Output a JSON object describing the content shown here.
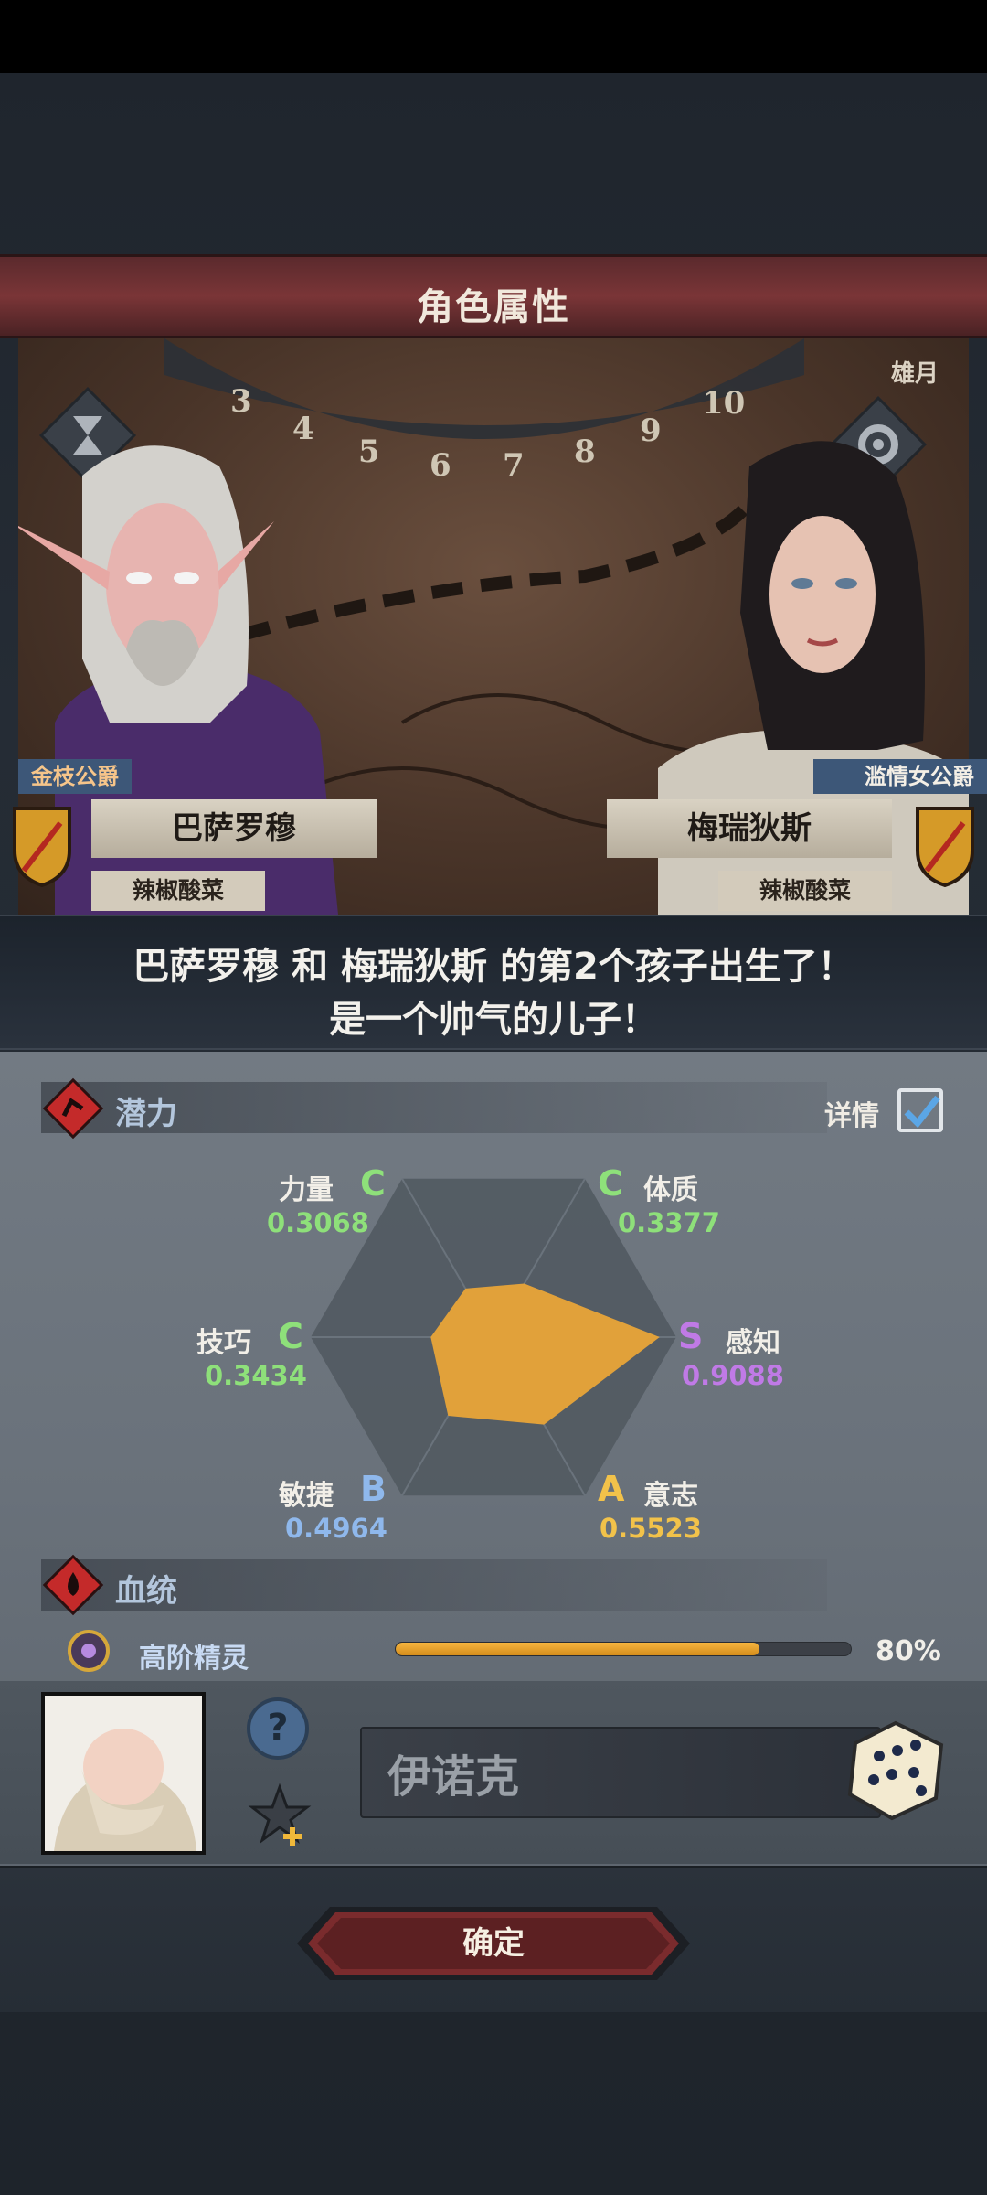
{
  "header": {
    "title": "角色属性"
  },
  "scene": {
    "map_label": "雄月"
  },
  "father": {
    "title": "金枝公爵",
    "name": "巴萨罗穆",
    "subtitle": "辣椒酸菜"
  },
  "mother": {
    "title": "滥情女公爵",
    "name": "梅瑞狄斯",
    "subtitle": "辣椒酸菜"
  },
  "message": {
    "line1": "巴萨罗穆 和 梅瑞狄斯 的第2个孩子出生了！",
    "line2": "是一个帅气的儿子！"
  },
  "potential": {
    "title": "潜力",
    "detail_label": "详情",
    "detail_checked": true,
    "stats": [
      {
        "name": "力量",
        "grade": "C",
        "value": "0.3068",
        "color": "#8ee07a",
        "level": 0.3068
      },
      {
        "name": "体质",
        "grade": "C",
        "value": "0.3377",
        "color": "#8ee07a",
        "level": 0.3377
      },
      {
        "name": "感知",
        "grade": "S",
        "value": "0.9088",
        "color": "#c07ae6",
        "level": 0.9088
      },
      {
        "name": "意志",
        "grade": "A",
        "value": "0.5523",
        "color": "#f2c24a",
        "level": 0.5523
      },
      {
        "name": "敏捷",
        "grade": "B",
        "value": "0.4964",
        "color": "#8fb8ec",
        "level": 0.4964
      },
      {
        "name": "技巧",
        "grade": "C",
        "value": "0.3434",
        "color": "#8ee07a",
        "level": 0.3434
      }
    ]
  },
  "bloodline": {
    "title": "血统",
    "race": "高阶精灵",
    "percent_label": "80%",
    "percent": 0.8
  },
  "child": {
    "name_value": "伊诺克"
  },
  "footer": {
    "confirm_label": "确定"
  },
  "colors": {
    "accent_red": "#7a3537",
    "radar_fill": "#e1a13a"
  }
}
